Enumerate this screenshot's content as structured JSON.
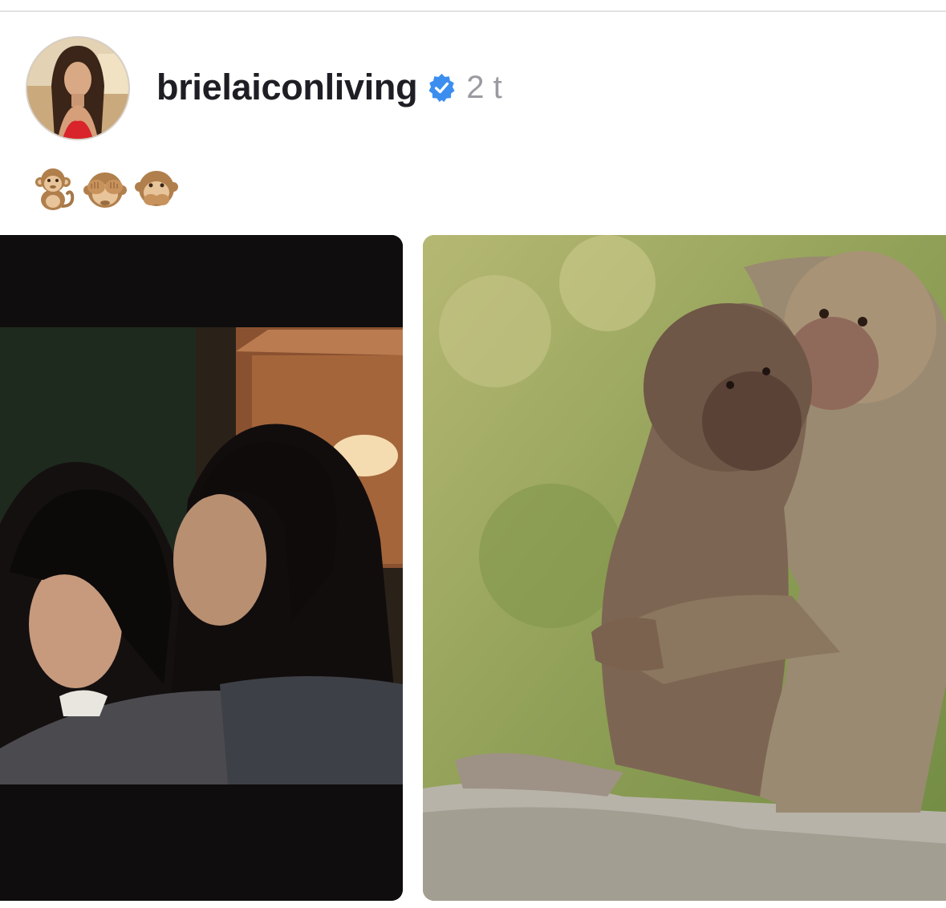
{
  "post": {
    "username": "brielaiconliving",
    "verified": true,
    "timestamp": "2 t",
    "caption_emojis": [
      {
        "icon": "monkey-icon",
        "char": "🐒"
      },
      {
        "icon": "see-no-evil-monkey-icon",
        "char": "🙈"
      },
      {
        "icon": "speak-no-evil-monkey-icon",
        "char": "🙊"
      }
    ],
    "media": [
      {
        "icon": "photo-two-women-hugging"
      },
      {
        "icon": "photo-two-baboons-hugging"
      }
    ]
  },
  "colors": {
    "username": "#1e1e24",
    "timestamp": "#9a9aa0",
    "verified_badge": "#3b8ef0"
  }
}
